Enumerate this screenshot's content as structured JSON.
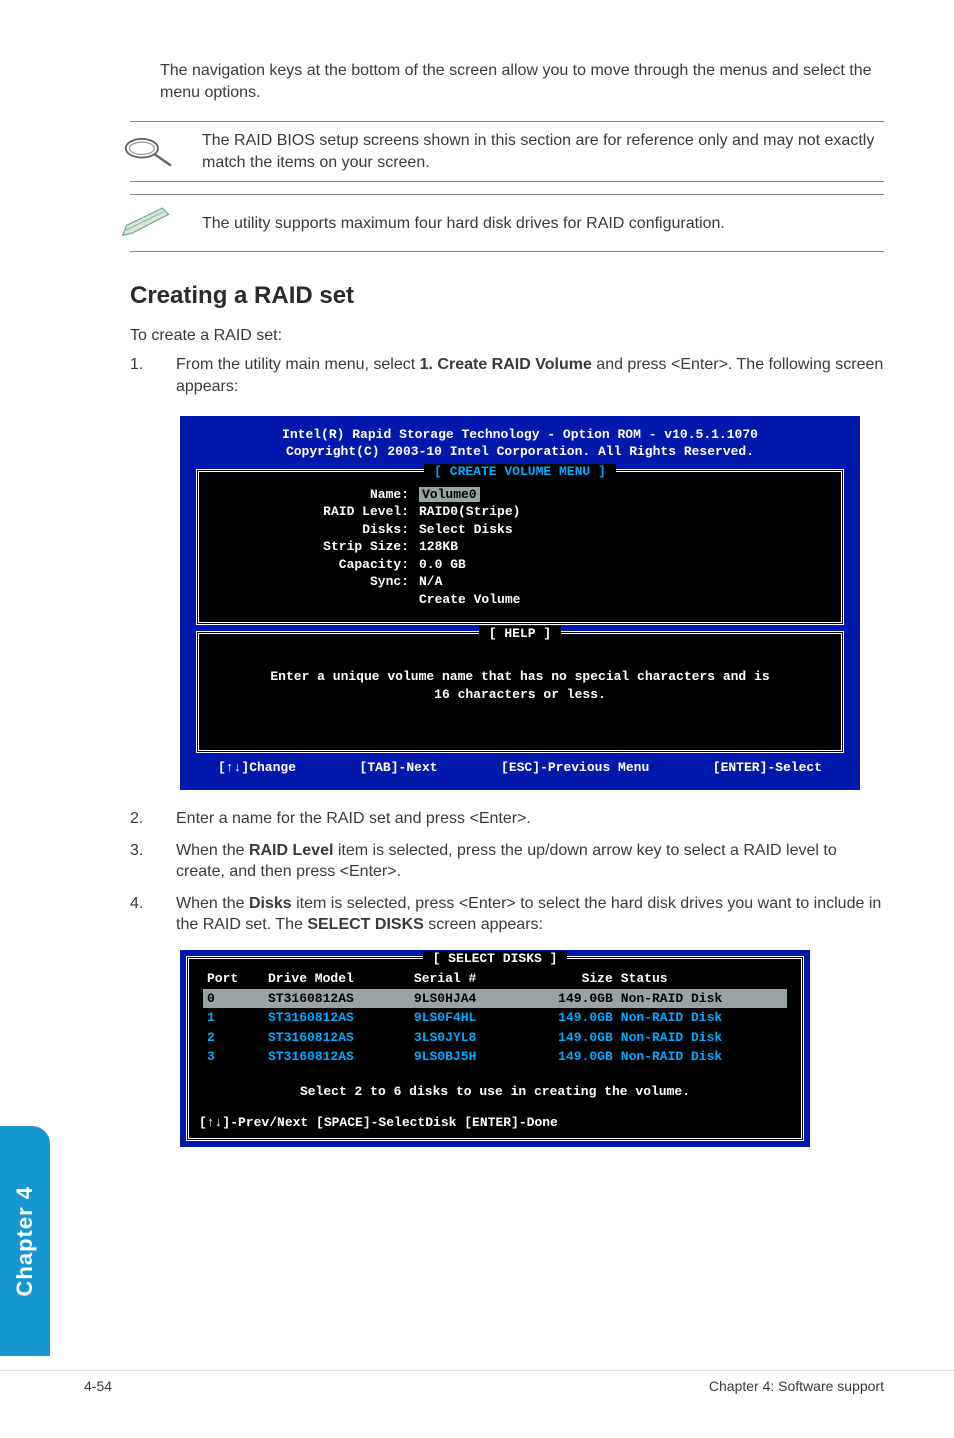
{
  "intro": "The navigation keys at the bottom of the screen allow you to move through the menus and select the menu options.",
  "note1": "The RAID BIOS setup screens shown in this section are for reference only and may not exactly match the items on your screen.",
  "note2": "The utility supports maximum four hard disk drives for RAID configuration.",
  "section_title": "Creating a RAID set",
  "section_sub": "To create a RAID set:",
  "steps": {
    "s1_a": "From the utility main menu, select ",
    "s1_b": "1. Create RAID Volume",
    "s1_c": " and press <Enter>. The following screen appears:",
    "s2": "Enter a name for the RAID set and press <Enter>.",
    "s3_a": "When the ",
    "s3_b": "RAID Level",
    "s3_c": " item is selected, press the up/down arrow key to select a RAID level to create, and then press <Enter>.",
    "s4_a": "When the ",
    "s4_b": "Disks",
    "s4_c": " item is selected, press <Enter> to select the hard disk drives you want to include in the RAID set. The ",
    "s4_d": "SELECT DISKS",
    "s4_e": " screen appears:"
  },
  "bios": {
    "header1": "Intel(R) Rapid Storage Technology - Option ROM - v10.5.1.1070",
    "header2": "Copyright(C) 2003-10 Intel Corporation.  All Rights Reserved.",
    "menu_label": "[ CREATE VOLUME MENU ]",
    "rows": [
      {
        "k": "Name:",
        "v": "Volume0",
        "hl": true
      },
      {
        "k": "RAID Level:",
        "v": "RAID0(Stripe)"
      },
      {
        "k": "Disks:",
        "v": "Select Disks"
      },
      {
        "k": "Strip Size:",
        "v": "128KB"
      },
      {
        "k": "Capacity:",
        "v": "0.0   GB"
      },
      {
        "k": "Sync:",
        "v": "N/A"
      },
      {
        "k": "",
        "v": "Create Volume"
      }
    ],
    "help_label": "[ HELP ]",
    "help_text1": "Enter a unique volume name that has no special characters and is",
    "help_text2": "16 characters or less.",
    "footer": [
      "[↑↓]Change",
      "[TAB]-Next",
      "[ESC]-Previous Menu",
      "[ENTER]-Select"
    ]
  },
  "disks": {
    "label": "[ SELECT DISKS ]",
    "headers": [
      "Port",
      "Drive Model",
      "Serial #",
      "Size",
      "Status"
    ],
    "rows": [
      {
        "sel": true,
        "c": [
          "0",
          "ST3160812AS",
          "9LS0HJA4",
          "149.0GB",
          "Non-RAID Disk"
        ]
      },
      {
        "sel": false,
        "c": [
          "1",
          "ST3160812AS",
          "9LS0F4HL",
          "149.0GB",
          "Non-RAID Disk"
        ]
      },
      {
        "sel": false,
        "c": [
          "2",
          "ST3160812AS",
          "3LS0JYL8",
          "149.0GB",
          "Non-RAID Disk"
        ]
      },
      {
        "sel": false,
        "c": [
          "3",
          "ST3160812AS",
          "9LS0BJ5H",
          "149.0GB",
          "Non-RAID Disk"
        ]
      }
    ],
    "msg": "Select 2 to 6 disks to use in creating the volume.",
    "footer": "[↑↓]-Prev/Next [SPACE]-SelectDisk [ENTER]-Done"
  },
  "side_tab": "Chapter 4",
  "page_left": "4-54",
  "page_right": "Chapter 4: Software support"
}
